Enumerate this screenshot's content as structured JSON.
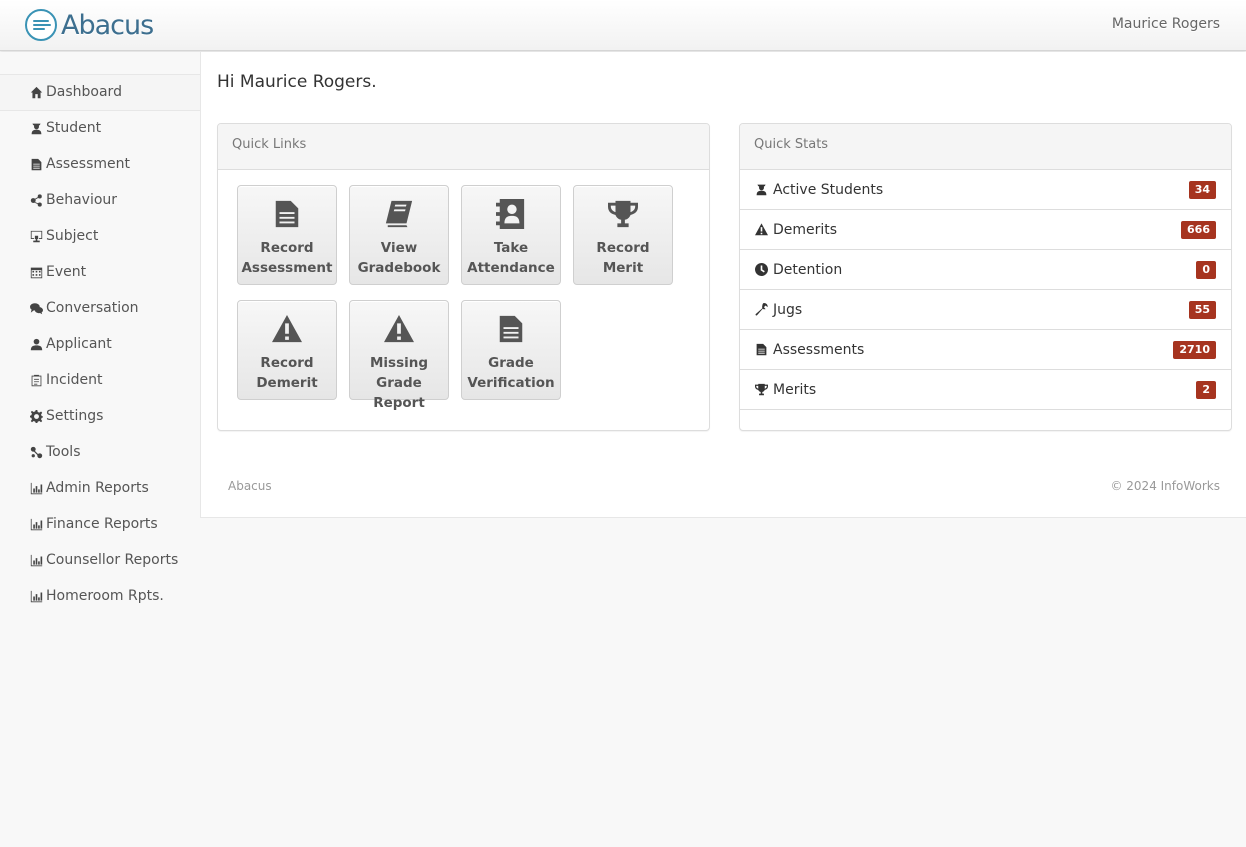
{
  "header": {
    "brand": "Abacus",
    "user": "Maurice Rogers",
    "brand_color": "#3a93b5"
  },
  "sidebar": {
    "items": [
      {
        "label": "Dashboard",
        "icon": "home-icon"
      },
      {
        "label": "Student",
        "icon": "student-icon"
      },
      {
        "label": "Assessment",
        "icon": "file-icon"
      },
      {
        "label": "Behaviour",
        "icon": "share-icon"
      },
      {
        "label": "Subject",
        "icon": "sitemap-icon"
      },
      {
        "label": "Event",
        "icon": "calendar-icon"
      },
      {
        "label": "Conversation",
        "icon": "comments-icon"
      },
      {
        "label": "Applicant",
        "icon": "user-icon"
      },
      {
        "label": "Incident",
        "icon": "clipboard-icon"
      },
      {
        "label": "Settings",
        "icon": "gear-icon"
      },
      {
        "label": "Tools",
        "icon": "tools-icon"
      },
      {
        "label": "Admin Reports",
        "icon": "bar-chart-icon"
      },
      {
        "label": "Finance Reports",
        "icon": "bar-chart-icon"
      },
      {
        "label": "Counsellor Reports",
        "icon": "bar-chart-icon"
      },
      {
        "label": "Homeroom Rpts.",
        "icon": "bar-chart-icon"
      }
    ]
  },
  "main": {
    "greeting": "Hi Maurice Rogers.",
    "quick_links": {
      "title": "Quick Links",
      "tiles": [
        {
          "label": "Record Assessment",
          "icon": "file-icon"
        },
        {
          "label": "View Gradebook",
          "icon": "book-icon"
        },
        {
          "label": "Take Attendance",
          "icon": "contact-book-icon"
        },
        {
          "label": "Record Merit",
          "icon": "trophy-icon"
        },
        {
          "label": "Record Demerit",
          "icon": "warning-icon"
        },
        {
          "label": "Missing Grade Report",
          "icon": "warning-icon"
        },
        {
          "label": "Grade Verification",
          "icon": "file-icon"
        }
      ]
    },
    "quick_stats": {
      "title": "Quick Stats",
      "badge_color": "#a6341f",
      "rows": [
        {
          "label": "Active Students",
          "value": "34",
          "icon": "student-icon"
        },
        {
          "label": "Demerits",
          "value": "666",
          "icon": "warning-icon"
        },
        {
          "label": "Detention",
          "value": "0",
          "icon": "clock-icon"
        },
        {
          "label": "Jugs",
          "value": "55",
          "icon": "wrench-icon"
        },
        {
          "label": "Assessments",
          "value": "2710",
          "icon": "file-icon"
        },
        {
          "label": "Merits",
          "value": "2",
          "icon": "trophy-icon"
        }
      ]
    }
  },
  "footer": {
    "left": "Abacus",
    "right": "© 2024 InfoWorks"
  }
}
